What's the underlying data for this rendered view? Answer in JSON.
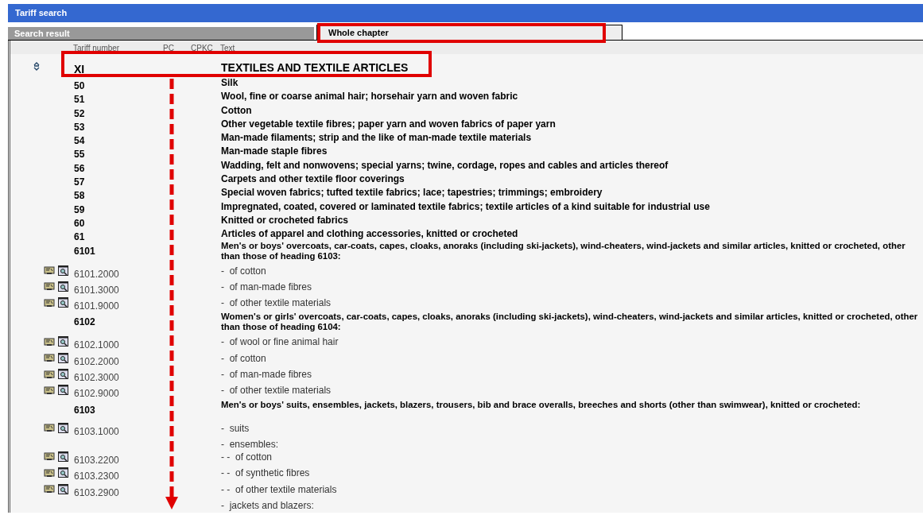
{
  "window": {
    "title": "Tariff search"
  },
  "tabs": [
    {
      "label": "Search result",
      "selected": false
    },
    {
      "label": "Whole chapter",
      "selected": true
    }
  ],
  "table": {
    "columns": [
      "Tariff number",
      "PC",
      "CPKC",
      "Text"
    ],
    "rows": [
      {
        "kind": "section",
        "number": "XI",
        "text": [
          "TEXTILES AND TEXTILE ARTICLES"
        ]
      },
      {
        "kind": "chapter",
        "number": "50",
        "text": [
          "Silk"
        ]
      },
      {
        "kind": "chapter",
        "number": "51",
        "text": [
          "Wool, fine or coarse animal hair; horsehair yarn and woven fabric"
        ]
      },
      {
        "kind": "chapter",
        "number": "52",
        "text": [
          "Cotton"
        ]
      },
      {
        "kind": "chapter",
        "number": "53",
        "text": [
          "Other vegetable textile fibres; paper yarn and woven fabrics of paper yarn"
        ]
      },
      {
        "kind": "chapter",
        "number": "54",
        "text": [
          "Man-made filaments; strip and the like of man-made textile materials"
        ]
      },
      {
        "kind": "chapter",
        "number": "55",
        "text": [
          "Man-made staple fibres"
        ]
      },
      {
        "kind": "chapter",
        "number": "56",
        "text": [
          "Wadding, felt and nonwovens; special yarns; twine, cordage, ropes and cables and articles thereof"
        ]
      },
      {
        "kind": "chapter",
        "number": "57",
        "text": [
          "Carpets and other textile floor coverings"
        ]
      },
      {
        "kind": "chapter",
        "number": "58",
        "text": [
          "Special woven fabrics; tufted textile fabrics; lace; tapestries; trimmings; embroidery"
        ]
      },
      {
        "kind": "chapter",
        "number": "59",
        "text": [
          "Impregnated, coated, covered or laminated textile fabrics; textile articles of a kind suitable for industrial use"
        ]
      },
      {
        "kind": "chapter",
        "number": "60",
        "text": [
          "Knitted or crocheted fabrics"
        ]
      },
      {
        "kind": "chapter",
        "number": "61",
        "text": [
          "Articles of apparel and clothing accessories, knitted or crocheted"
        ]
      },
      {
        "kind": "heading",
        "number": "6101",
        "text": [
          "Men's or boys' overcoats, car-coats, capes, cloaks, anoraks (including ski-jackets), wind-cheaters, wind-jackets and similar articles, knitted or crocheted, other",
          "than those of heading 6103:"
        ]
      },
      {
        "kind": "tariff",
        "number": "6101.2000",
        "text": [
          "-  of cotton"
        ]
      },
      {
        "kind": "tariff",
        "number": "6101.3000",
        "text": [
          "-  of man-made fibres"
        ]
      },
      {
        "kind": "tariff",
        "number": "6101.9000",
        "text": [
          "-  of other textile materials"
        ]
      },
      {
        "kind": "heading",
        "number": "6102",
        "text": [
          "Women's or girls' overcoats, car-coats, capes, cloaks, anoraks (including ski-jackets), wind-cheaters, wind-jackets and similar articles, knitted or crocheted, other",
          "than those of heading 6104:"
        ]
      },
      {
        "kind": "tariff",
        "number": "6102.1000",
        "text": [
          "-  of wool or fine animal hair"
        ]
      },
      {
        "kind": "tariff",
        "number": "6102.2000",
        "text": [
          "-  of cotton"
        ]
      },
      {
        "kind": "tariff",
        "number": "6102.3000",
        "text": [
          "-  of man-made fibres"
        ]
      },
      {
        "kind": "tariff",
        "number": "6102.9000",
        "text": [
          "-  of other textile materials"
        ]
      },
      {
        "kind": "heading",
        "number": "6103",
        "text": [
          "Men's or boys' suits, ensembles, jackets, blazers, trousers, bib and brace overalls, breeches and shorts (other than swimwear), knitted or crocheted:"
        ]
      },
      {
        "kind": "tariff",
        "number": "6103.1000",
        "text": [
          "-  suits"
        ]
      },
      {
        "kind": "group",
        "text": [
          "-  ensembles:"
        ]
      },
      {
        "kind": "tariff",
        "number": "6103.2200",
        "text": [
          "- -  of cotton"
        ]
      },
      {
        "kind": "tariff",
        "number": "6103.2300",
        "text": [
          "- -  of synthetic fibres"
        ]
      },
      {
        "kind": "tariff",
        "number": "6103.2900",
        "text": [
          "- -  of other textile materials"
        ]
      },
      {
        "kind": "group",
        "text": [
          "-  jackets and blazers:"
        ]
      }
    ]
  }
}
